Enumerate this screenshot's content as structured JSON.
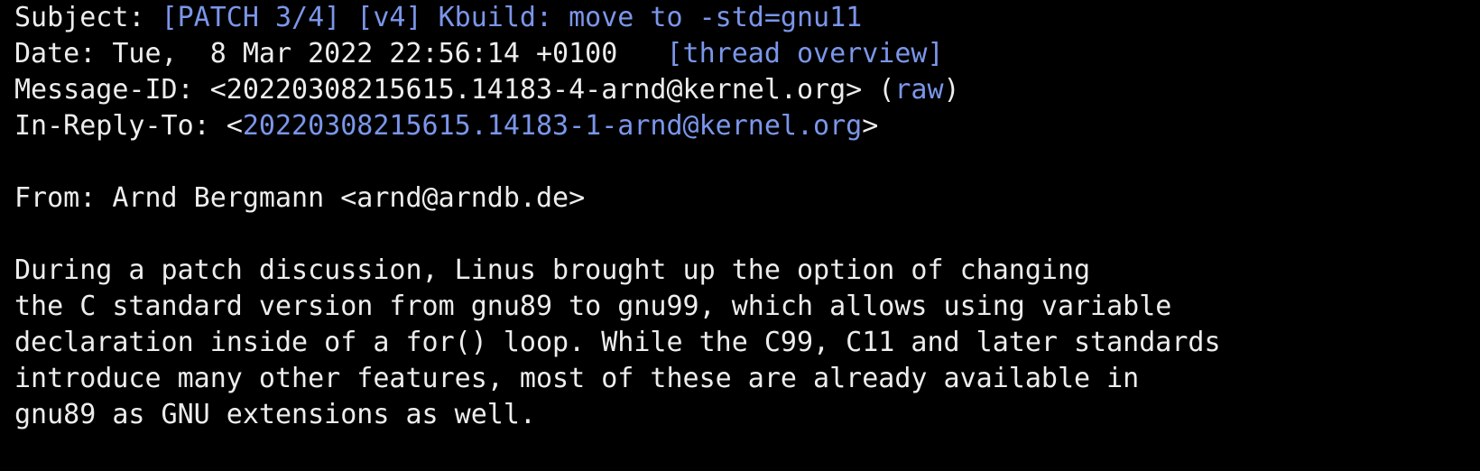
{
  "colors": {
    "background": "#000000",
    "text": "#ededed",
    "link": "#7b96ea"
  },
  "header": {
    "subject_label": "Subject: ",
    "subject_link": "[PATCH 3/4] [v4] Kbuild: move to -std=gnu11",
    "date_label": "Date: ",
    "date_value": "Tue,  8 Mar 2022 22:56:14 +0100",
    "date_spacer": "   ",
    "thread_overview_link": "[thread overview]",
    "message_id_label": "Message-ID: ",
    "message_id_value": "<20220308215615.14183-4-arnd@kernel.org>",
    "raw_open": " (",
    "raw_link": "raw",
    "raw_close": ")",
    "in_reply_to_label": "In-Reply-To: ",
    "in_reply_to_open": "<",
    "in_reply_to_link": "20220308215615.14183-1-arnd@kernel.org",
    "in_reply_to_close": ">"
  },
  "from": {
    "label": "From: ",
    "value": "Arnd Bergmann <arnd@arndb.de>"
  },
  "body": {
    "lines": [
      "During a patch discussion, Linus brought up the option of changing",
      "the C standard version from gnu89 to gnu99, which allows using variable",
      "declaration inside of a for() loop. While the C99, C11 and later standards",
      "introduce many other features, most of these are already available in",
      "gnu89 as GNU extensions as well."
    ]
  }
}
